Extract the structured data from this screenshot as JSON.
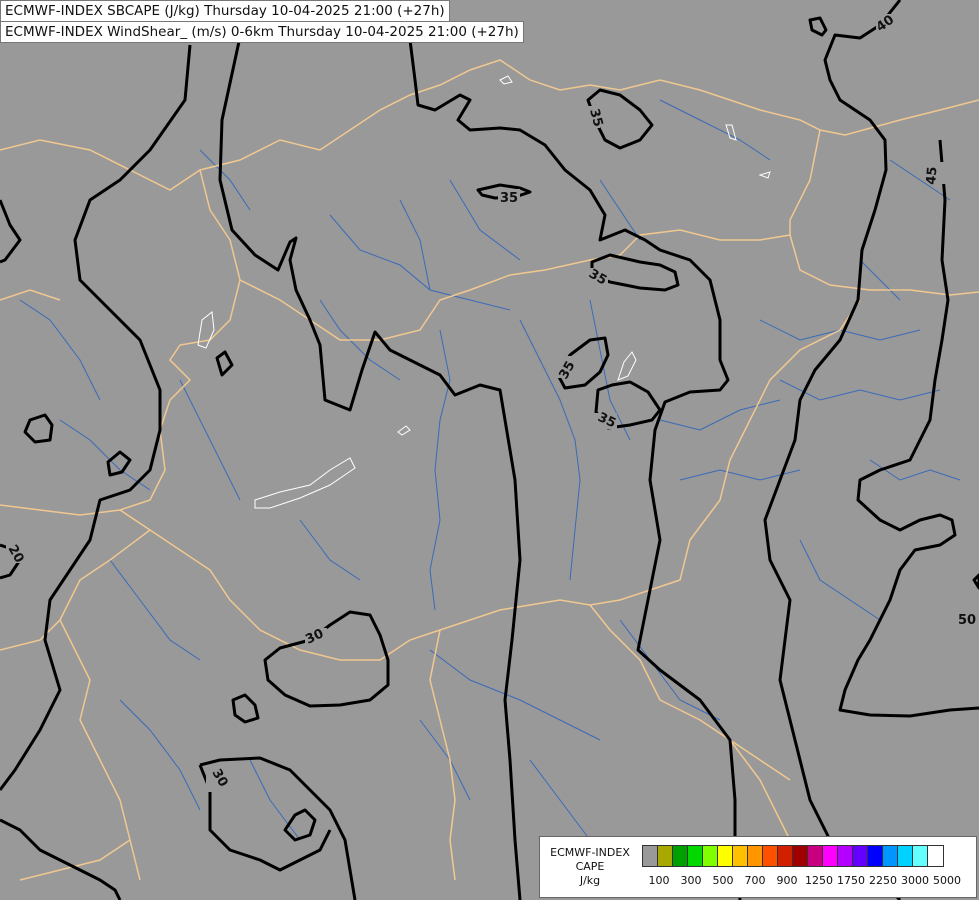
{
  "header": {
    "line1": "ECMWF-INDEX SBCAPE (J/kg) Thursday 10-04-2025 21:00 (+27h)",
    "line2": "ECMWF-INDEX WindShear_ (m/s) 0-6km Thursday 10-04-2025 21:00 (+27h)"
  },
  "map": {
    "background_color": "#999999",
    "border_color": "#f0c890",
    "river_color": "#3a6ab8",
    "contour_color": "#000000",
    "contour_labels": [
      "40",
      "35",
      "35",
      "45",
      "35",
      "35",
      "35",
      "20",
      "30",
      "50",
      "30"
    ]
  },
  "legend": {
    "title_line1": "ECMWF-INDEX",
    "title_line2": "CAPE",
    "title_line3": "J/kg",
    "colors": [
      "#999999",
      "#a8a800",
      "#00a000",
      "#00d800",
      "#80ff00",
      "#ffff00",
      "#ffc000",
      "#ff9600",
      "#ff5000",
      "#d02000",
      "#a00000",
      "#c80080",
      "#ff00ff",
      "#b400ff",
      "#6400ff",
      "#0000ff",
      "#0096ff",
      "#00d2ff",
      "#64ffff",
      "#ffffff"
    ],
    "tick_labels": [
      "100",
      "300",
      "500",
      "700",
      "900",
      "1250",
      "1750",
      "2250",
      "3000",
      "5000"
    ]
  }
}
